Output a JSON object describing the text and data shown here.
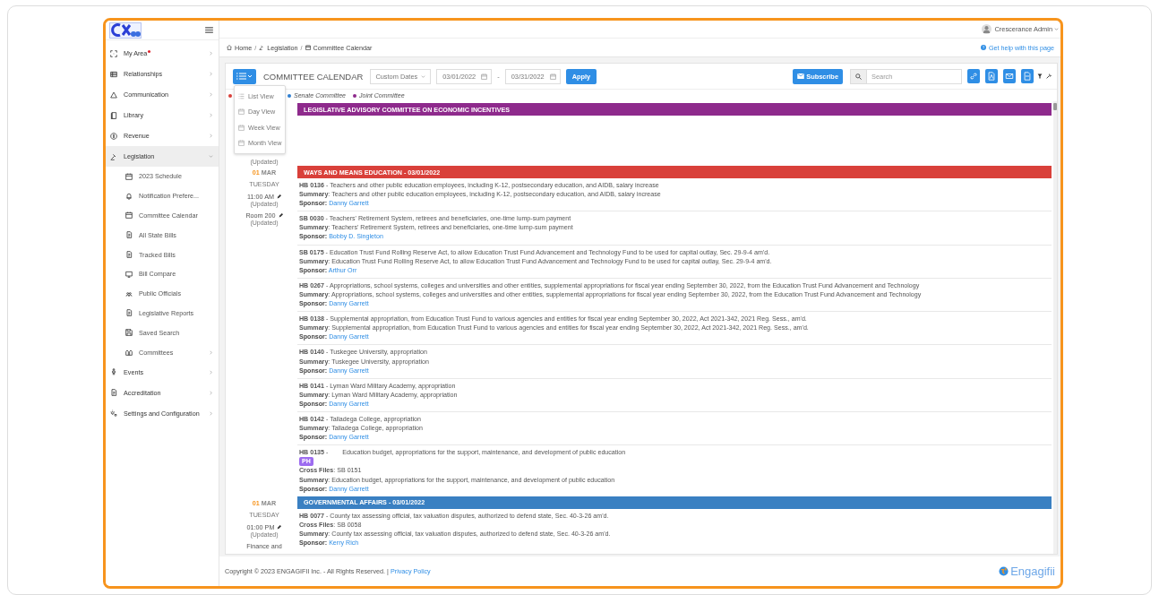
{
  "user": {
    "name": "Crescerance Admin"
  },
  "sidebar": {
    "items": [
      {
        "label": "My Area",
        "notify": true,
        "has_children": true,
        "expanded": false,
        "selected": false
      },
      {
        "label": "Relationships",
        "notify": false,
        "has_children": true,
        "expanded": false,
        "selected": false
      },
      {
        "label": "Communication",
        "notify": false,
        "has_children": true,
        "expanded": false,
        "selected": false
      },
      {
        "label": "Library",
        "notify": false,
        "has_children": true,
        "expanded": false,
        "selected": false
      },
      {
        "label": "Revenue",
        "notify": false,
        "has_children": true,
        "expanded": false,
        "selected": false
      },
      {
        "label": "Legislation",
        "notify": false,
        "has_children": true,
        "expanded": true,
        "selected": true,
        "children": [
          {
            "label": "2023 Schedule",
            "has_children": false,
            "selected": false
          },
          {
            "label": "Notification Prefere...",
            "has_children": false,
            "selected": false
          },
          {
            "label": "Committee Calendar",
            "has_children": false,
            "selected": false
          },
          {
            "label": "All State Bills",
            "has_children": false,
            "selected": false
          },
          {
            "label": "Tracked Bills",
            "has_children": false,
            "selected": false
          },
          {
            "label": "Bill Compare",
            "has_children": false,
            "selected": false
          },
          {
            "label": "Public Officials",
            "has_children": false,
            "selected": false
          },
          {
            "label": "Legislative Reports",
            "has_children": false,
            "selected": false
          },
          {
            "label": "Saved Search",
            "has_children": false,
            "selected": false
          },
          {
            "label": "Committees",
            "has_children": true,
            "selected": false
          }
        ]
      },
      {
        "label": "Events",
        "notify": false,
        "has_children": true,
        "expanded": false,
        "selected": false
      },
      {
        "label": "Accreditation",
        "notify": false,
        "has_children": true,
        "expanded": false,
        "selected": false
      },
      {
        "label": "Settings and Configuration",
        "notify": false,
        "has_children": true,
        "expanded": false,
        "selected": false
      }
    ]
  },
  "breadcrumb": [
    "Home",
    "Legislation",
    "Committee Calendar"
  ],
  "breadcrumb_separator": "/",
  "help_link": "Get help with this page",
  "toolbar": {
    "title": "COMMITTEE CALENDAR",
    "range": "Custom Dates",
    "date_from": "03/01/2022",
    "separator": "-",
    "date_to": "03/31/2022",
    "apply": "Apply",
    "subscribe": "Subscribe",
    "search": {
      "placeholder": "Search"
    }
  },
  "view_menu": {
    "open": true,
    "items": [
      {
        "label": "List View"
      },
      {
        "label": "Day View"
      },
      {
        "label": "Week View"
      },
      {
        "label": "Month View"
      }
    ]
  },
  "legend": [
    {
      "color": "#d9403a"
    },
    {
      "label": "Senate Committee",
      "color": "#2f7fd1"
    },
    {
      "label": "Joint Committee",
      "color": "#8e2a8c"
    }
  ],
  "events": [
    {
      "title": "LEGISLATIVE ADVISORY COMMITTEE ON ECONOMIC INCENTIVES",
      "color": "#8e2a8c",
      "side": [
        {
          "kind": "note",
          "text": "(Updated)"
        }
      ]
    },
    {
      "title": "WAYS AND MEANS EDUCATION - 03/01/2022",
      "color": "#d9403a",
      "side": [
        {
          "kind": "date",
          "day": "01",
          "month": "MAR"
        },
        {
          "kind": "weekday",
          "text": "TUESDAY"
        },
        {
          "kind": "time",
          "text": "11:00 AM"
        },
        {
          "kind": "note",
          "text": "(Updated)"
        },
        {
          "kind": "room",
          "text": "Room 200"
        },
        {
          "kind": "note",
          "text": "(Updated)"
        }
      ],
      "bills": [
        {
          "title": "**HB 0136** - Teachers and other public education employees, including K-12, postsecondary education, and AIDB, salary increase",
          "summary": "**Summary**: Teachers and other public education employees, including K-12, postsecondary education, and AIDB, salary increase",
          "sponsor_label": "Sponsor:",
          "sponsor": "Danny Garrett"
        },
        {
          "title": "**SB 0030** - Teachers' Retirement System, retirees and beneficiaries, one-time lump-sum payment",
          "summary": "**Summary**: Teachers' Retirement System, retirees and beneficiaries, one-time lump-sum payment",
          "sponsor_label": "Sponsor:",
          "sponsor": "Bobby D. Singleton"
        },
        {
          "title": "**SB 0175** - Education Trust Fund Rolling Reserve Act, to allow Education Trust Fund Advancement and Technology Fund to be used for capital outlay, Sec. 29-9-4 am'd.",
          "summary": "**Summary**: Education Trust Fund Rolling Reserve Act, to allow Education Trust Fund Advancement and Technology Fund to be used for capital outlay, Sec. 29-9-4 am'd.",
          "sponsor_label": "Sponsor:",
          "sponsor": "Arthur Orr"
        },
        {
          "title": "**HB 0267** - Appropriations, school systems, colleges and universities and other entities, supplemental appropriations for fiscal year ending September 30, 2022, from the Education Trust Fund Advancement and Technology",
          "summary": "**Summary**: Appropriations, school systems, colleges and universities and other entities, supplemental appropriations for fiscal year ending September 30, 2022, from the Education Trust Fund Advancement and Technology",
          "sponsor_label": "Sponsor:",
          "sponsor": "Danny Garrett"
        },
        {
          "title": "**HB 0138** - Supplemental appropriation, from Education Trust Fund to various agencies and entities for fiscal year ending September 30, 2022, Act 2021-342, 2021 Reg. Sess., am'd.",
          "summary": "**Summary**: Supplemental appropriation, from Education Trust Fund to various agencies and entities for fiscal year ending September 30, 2022, Act 2021-342, 2021 Reg. Sess., am'd.",
          "sponsor_label": "Sponsor:",
          "sponsor": "Danny Garrett"
        },
        {
          "title": "**HB 0140** - Tuskegee University, appropriation",
          "summary": "**Summary**: Tuskegee University, appropriation",
          "sponsor_label": "Sponsor:",
          "sponsor": "Danny Garrett"
        },
        {
          "title": "**HB 0141** - Lyman Ward Military Academy, appropriation",
          "summary": "**Summary**: Lyman Ward Military Academy, appropriation",
          "sponsor_label": "Sponsor:",
          "sponsor": "Danny Garrett"
        },
        {
          "title": "**HB 0142** - Talladega College, appropriation",
          "summary": "**Summary**: Talladega College, appropriation",
          "sponsor_label": "Sponsor:",
          "sponsor": "Danny Garrett"
        },
        {
          "title": "**HB 0135** -",
          "detail": "Education budget, appropriations for the support, maintenance, and development of public education",
          "badge": "PH",
          "cross_files": "**Cross Files**: SB 0151",
          "summary": "**Summary**: Education budget, appropriations for the support, maintenance, and development of public education",
          "sponsor_label": "Sponsor:",
          "sponsor": "Danny Garrett"
        }
      ]
    },
    {
      "title": "GOVERNMENTAL AFFAIRS - 03/01/2022",
      "color": "#3a80c2",
      "side": [
        {
          "kind": "date",
          "day": "01",
          "month": "MAR"
        },
        {
          "kind": "weekday",
          "text": "TUESDAY"
        },
        {
          "kind": "time",
          "text": "01:00 PM"
        },
        {
          "kind": "note",
          "text": "(Updated)"
        },
        {
          "kind": "text",
          "text": "Finance and"
        }
      ],
      "bills": [
        {
          "title": "**HB 0077** - County tax assessing official, tax valuation disputes, authorized to defend state, Sec. 40-3-26 am'd.",
          "cross_files": "**Cross Files**: SB 0058",
          "summary": "**Summary**: County tax assessing official, tax valuation disputes, authorized to defend state, Sec. 40-3-26 am'd.",
          "sponsor_label": "Sponsor:",
          "sponsor": "Kerry Rich"
        }
      ]
    }
  ],
  "footer": {
    "copyright": "Copyright © 2023 ENGAGIFII Inc. - All Rights Reserved. |",
    "privacy": "Privacy Policy",
    "brand": "Engagifii"
  }
}
